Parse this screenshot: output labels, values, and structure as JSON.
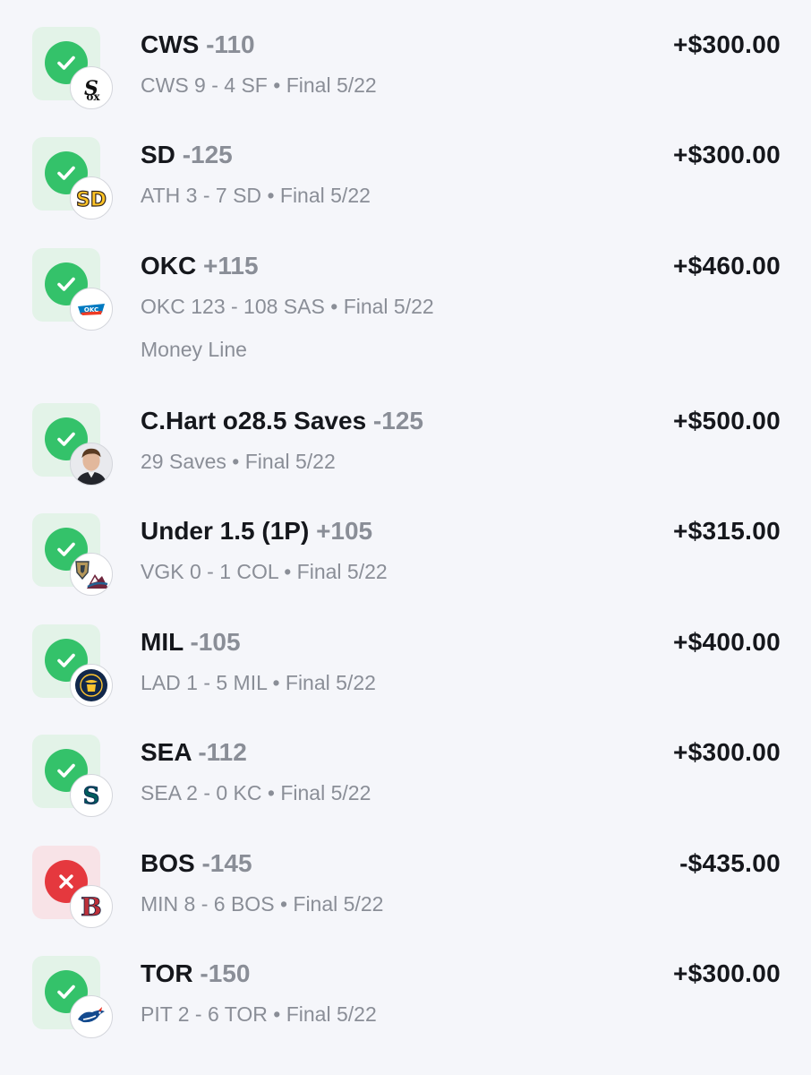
{
  "bets": [
    {
      "pick": "CWS",
      "odds": "-110",
      "amount": "+$300.00",
      "result": "CWS 9 - 4 SF",
      "status": "Final 5/22",
      "outcome": "win",
      "logo_icon": "white-sox-logo-icon"
    },
    {
      "pick": "SD",
      "odds": "-125",
      "amount": "+$300.00",
      "result": "ATH 3 - 7 SD",
      "status": "Final 5/22",
      "outcome": "win",
      "logo_icon": "padres-logo-icon"
    },
    {
      "pick": "OKC",
      "odds": "+115",
      "amount": "+$460.00",
      "result": "OKC 123 - 108 SAS",
      "status": "Final 5/22",
      "market": "Money Line",
      "outcome": "win",
      "logo_icon": "thunder-logo-icon"
    },
    {
      "pick": "C.Hart o28.5 Saves",
      "odds": "-125",
      "amount": "+$500.00",
      "result": "29 Saves",
      "status": "Final 5/22",
      "outcome": "win",
      "logo_icon": "player-headshot-icon"
    },
    {
      "pick": "Under 1.5 (1P)",
      "odds": "+105",
      "amount": "+$315.00",
      "result": "VGK 0 - 1 COL",
      "status": "Final 5/22",
      "outcome": "win",
      "logo_icon": "golden-knights-avalanche-logo-icon"
    },
    {
      "pick": "MIL",
      "odds": "-105",
      "amount": "+$400.00",
      "result": "LAD 1 - 5 MIL",
      "status": "Final 5/22",
      "outcome": "win",
      "logo_icon": "brewers-logo-icon"
    },
    {
      "pick": "SEA",
      "odds": "-112",
      "amount": "+$300.00",
      "result": "SEA 2 - 0 KC",
      "status": "Final 5/22",
      "outcome": "win",
      "logo_icon": "mariners-logo-icon"
    },
    {
      "pick": "BOS",
      "odds": "-145",
      "amount": "-$435.00",
      "result": "MIN 8 - 6 BOS",
      "status": "Final 5/22",
      "outcome": "loss",
      "logo_icon": "red-sox-logo-icon"
    },
    {
      "pick": "TOR",
      "odds": "-150",
      "amount": "+$300.00",
      "result": "PIT 2 - 6 TOR",
      "status": "Final 5/22",
      "outcome": "win",
      "logo_icon": "blue-jays-logo-icon"
    }
  ],
  "separator": "•",
  "colors": {
    "background": "#f5f6fa",
    "win_tile": "#e3f3e8",
    "win_check": "#34c26a",
    "loss_tile": "#f8e3e7",
    "loss_x": "#e5383e",
    "primary_text": "#15171c",
    "secondary_text": "#8a8e97"
  }
}
